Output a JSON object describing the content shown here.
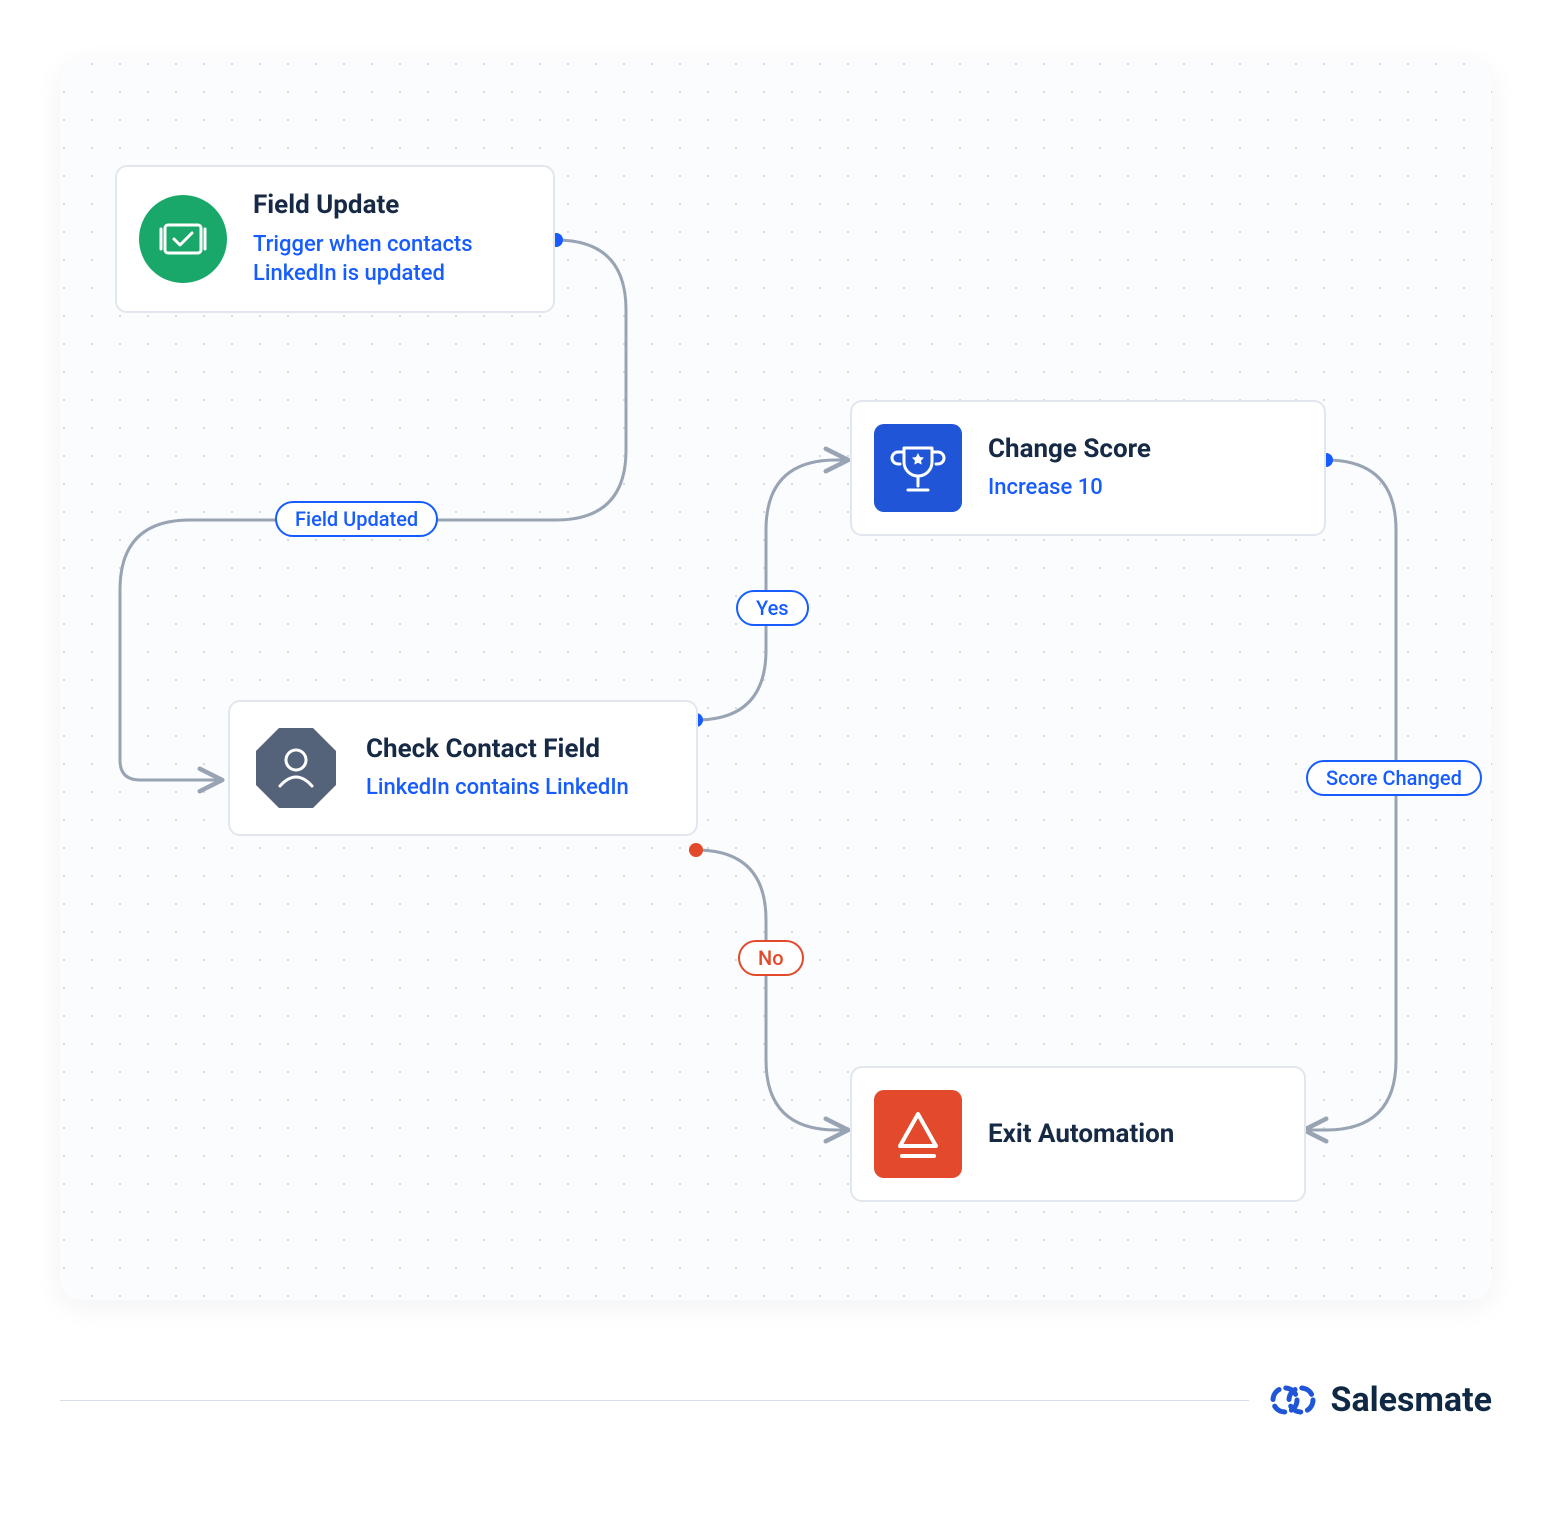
{
  "nodes": {
    "field_update": {
      "title": "Field Update",
      "desc": "Trigger when contacts LinkedIn is updated"
    },
    "check_contact": {
      "title": "Check Contact Field",
      "desc": "LinkedIn contains LinkedIn"
    },
    "change_score": {
      "title": "Change Score",
      "desc": "Increase 10"
    },
    "exit_automation": {
      "title": "Exit Automation"
    }
  },
  "labels": {
    "field_updated": "Field Updated",
    "yes": "Yes",
    "no": "No",
    "score_changed": "Score Changed"
  },
  "brand": {
    "name": "Salesmate"
  },
  "colors": {
    "accent_blue": "#175cff",
    "node_border": "#e2e6ef",
    "green": "#1aa86a",
    "slate": "#54627a",
    "square_blue": "#1f55d6",
    "red_orange": "#e24a2b",
    "text_dark": "#162945",
    "connector": "#98a3b3"
  }
}
